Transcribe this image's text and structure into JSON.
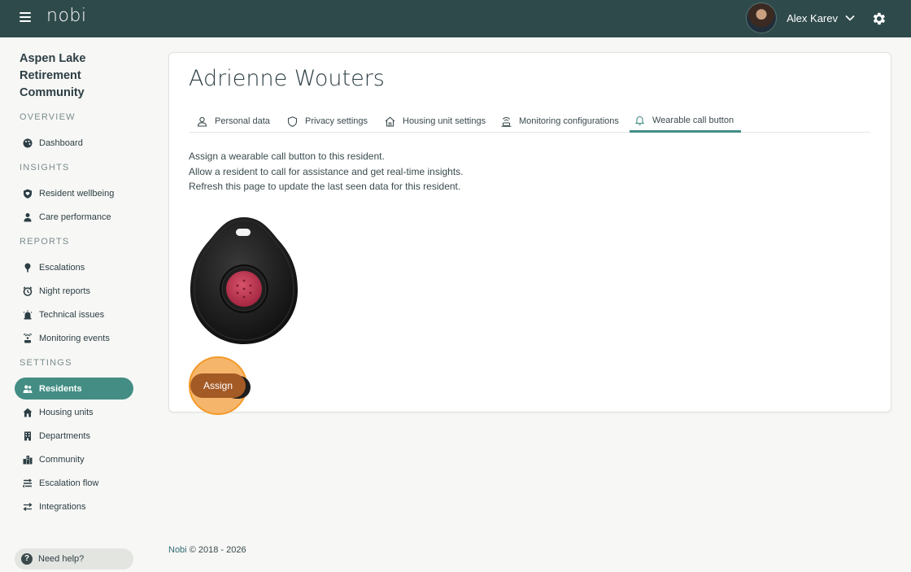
{
  "header": {
    "logo": "nobi",
    "user_name": "Alex Karev"
  },
  "sidebar": {
    "community_name": "Aspen Lake Retirement Community",
    "sections": {
      "overview": "OVERVIEW",
      "insights": "INSIGHTS",
      "reports": "REPORTS",
      "settings": "SETTINGS"
    },
    "items": [
      {
        "label": "Dashboard",
        "icon": "palette-icon"
      },
      {
        "label": "Resident wellbeing",
        "icon": "shield-heart-icon"
      },
      {
        "label": "Care performance",
        "icon": "person-badge-icon"
      },
      {
        "label": "Escalations",
        "icon": "pin-icon"
      },
      {
        "label": "Night reports",
        "icon": "alarm-clock-icon"
      },
      {
        "label": "Technical issues",
        "icon": "alarm-icon"
      },
      {
        "label": "Monitoring events",
        "icon": "broadcast-icon"
      },
      {
        "label": "Residents",
        "icon": "users-icon",
        "active": true
      },
      {
        "label": "Housing units",
        "icon": "house-icon"
      },
      {
        "label": "Departments",
        "icon": "building-icon"
      },
      {
        "label": "Community",
        "icon": "city-icon"
      },
      {
        "label": "Escalation flow",
        "icon": "flow-icon"
      },
      {
        "label": "Integrations",
        "icon": "arrows-icon"
      }
    ],
    "help_label": "Need help?"
  },
  "main": {
    "resident_name": "Adrienne Wouters",
    "tabs": [
      {
        "label": "Personal data",
        "icon": "person-icon"
      },
      {
        "label": "Privacy settings",
        "icon": "shield-icon"
      },
      {
        "label": "Housing unit settings",
        "icon": "house-icon"
      },
      {
        "label": "Monitoring configurations",
        "icon": "sensor-icon"
      },
      {
        "label": "Wearable call button",
        "icon": "bell-icon",
        "active": true
      }
    ],
    "description": [
      "Assign a wearable call button to this resident.",
      "Allow a resident to call for assistance and get real-time insights.",
      "Refresh this page to update the last seen data for this resident."
    ],
    "assign_label": "Assign"
  },
  "footer": {
    "brand": "Nobi",
    "copyright": "© 2018 - 2026"
  },
  "colors": {
    "topbar": "#2f4a4b",
    "accent": "#438d84",
    "assign_button": "#a45a25",
    "highlight": "#f5b66c"
  }
}
